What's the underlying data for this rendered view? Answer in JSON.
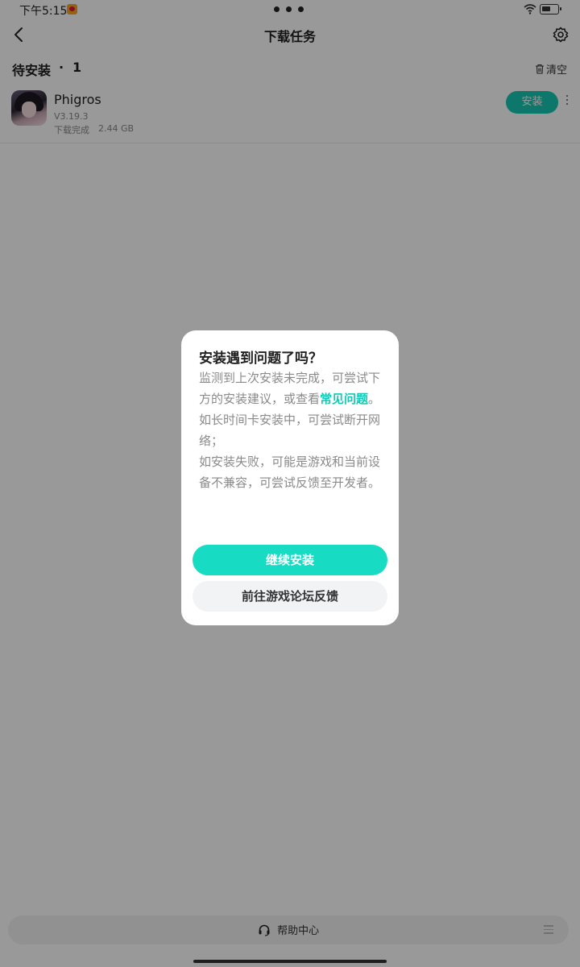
{
  "status_bar": {
    "time": "下午5:15"
  },
  "nav": {
    "title": "下载任务"
  },
  "section": {
    "title": "待安装",
    "separator": "·",
    "count": "1",
    "clear_label": "清空"
  },
  "app": {
    "name": "Phigros",
    "version": "V3.19.3",
    "status": "下载完成",
    "size": "2.44 GB",
    "install_label": "安装"
  },
  "dialog": {
    "title": "安装遇到问题了吗？",
    "para1_before": "监测到上次安装未完成，可尝试下方的安装建议，或查看",
    "para1_link": "常见问题",
    "para1_after": "。",
    "para2": "如长时间卡安装中，可尝试断开网络；",
    "para3": "如安装失败，可能是游戏和当前设备不兼容，可尝试反馈至开发者。",
    "primary_button": "继续安装",
    "secondary_button": "前往游戏论坛反馈"
  },
  "help_bar": {
    "label": "帮助中心"
  },
  "colors": {
    "accent": "#17c7b3",
    "overlay": "rgba(0,0,0,0.40)"
  }
}
